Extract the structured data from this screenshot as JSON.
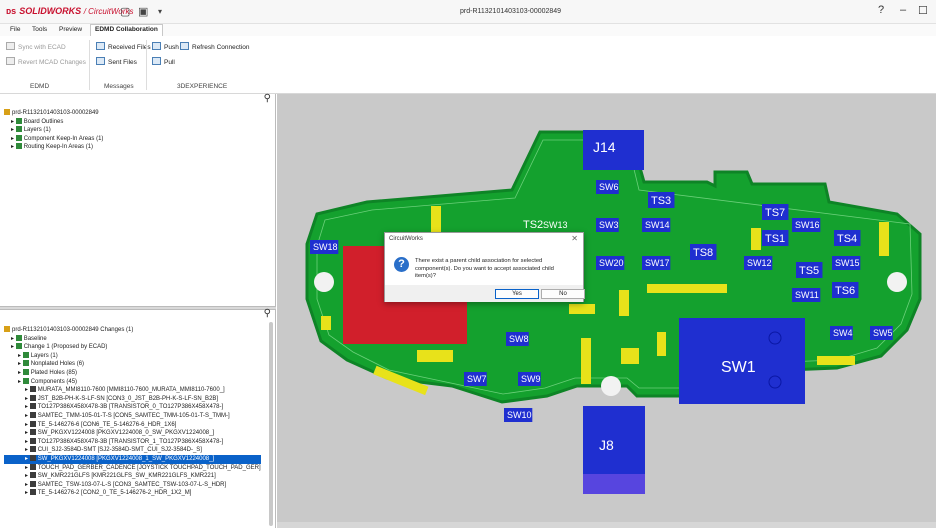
{
  "app": {
    "brand": "SOLIDWORKS",
    "product": "CircuitWorks",
    "doc_title": "prd-R1132101403103-00002849",
    "help_glyph": "?",
    "minimize_glyph": "–",
    "maximize_glyph": "☐"
  },
  "menu": {
    "tabs": [
      {
        "label": "File"
      },
      {
        "label": "Tools"
      },
      {
        "label": "Preview"
      },
      {
        "label": "EDMD Collaboration"
      }
    ]
  },
  "ribbon": {
    "sync_ecad": "Sync with ECAD",
    "revert_mcad": "Revert MCAD Changes",
    "received_files": "Received Files",
    "sent_files": "Sent Files",
    "push": "Push",
    "refresh": "Refresh Connection",
    "pull": "Pull",
    "groups": {
      "edmd": "EDMD",
      "messages": "Messages",
      "experience": "3DEXPERIENCE"
    }
  },
  "top_tree": [
    {
      "label": "prd-R1132101403103-00002849",
      "level": 0
    },
    {
      "label": "Board Outlines",
      "level": 1
    },
    {
      "label": "Layers (1)",
      "level": 1
    },
    {
      "label": "Component Keep-In Areas (1)",
      "level": 1
    },
    {
      "label": "Routing Keep-In Areas (1)",
      "level": 1
    }
  ],
  "bottom_tree": [
    {
      "label": "prd-R1132101403103-00002849  Changes  (1)",
      "level": 0
    },
    {
      "label": "Baseline",
      "level": 1
    },
    {
      "label": "Change 1 (Proposed by ECAD)",
      "level": 1
    },
    {
      "label": "Layers (1)",
      "level": 2
    },
    {
      "label": "Nonplated Holes (6)",
      "level": 2
    },
    {
      "label": "Plated Holes (85)",
      "level": 2
    },
    {
      "label": "Components (45)",
      "level": 2
    },
    {
      "label": "MURATA_MMI8110-7600 [MMI8110-7600_MURATA_MMI8110-7600_]",
      "level": 3
    },
    {
      "label": "JST_B2B-PH-K-S-LF-SN [CON3_0_JST_B2B-PH-K-S-LF-SN_B2B]",
      "level": 3
    },
    {
      "label": "TO127P386X458X478-3B [TRANSISTOR_0_TO127P386X458X478-]",
      "level": 3
    },
    {
      "label": "SAMTEC_TMM-105-01-T-S [CON5_SAMTEC_TMM-105-01-T-S_TMM-]",
      "level": 3
    },
    {
      "label": "TE_5-146276-6 [CON6_TE_5-146276-6_HDR_1X6]",
      "level": 3
    },
    {
      "label": "SW_PKGXV1224008 [PKGXV1224008_0_SW_PKGXV1224008_]",
      "level": 3
    },
    {
      "label": "TO127P386X458X478-3B [TRANSISTOR_1_TO127P386X458X478-]",
      "level": 3
    },
    {
      "label": "CUI_SJ2-3584D-SMT [SJ2-3584D-SMT_CUI_SJ2-3584D-_S]",
      "level": 3
    },
    {
      "label": "SW_PKGXV1224008 [PKGXV1224008_1_SW_PKGXV1224008_]",
      "level": 3,
      "selected": true
    },
    {
      "label": "TOUCH_PAD_GERBER_CADENCE [JOYSTICK TOUCHPAD_TOUCH_PAD_GER]",
      "level": 3
    },
    {
      "label": "SW_KMR221GLFS [KMR221GLFS_SW_KMR221GLFS_KMR221]",
      "level": 3
    },
    {
      "label": "SAMTEC_TSW-103-07-L-S [CON3_SAMTEC_TSW-103-07-L-S_HDR]",
      "level": 3
    },
    {
      "label": "TE_5-146276-2 [CON2_0_TE_5-146276-2_HDR_1X2_M]",
      "level": 3
    }
  ],
  "pcb": {
    "labels": {
      "J14": "J14",
      "SW6": "SW6",
      "TS3": "TS3",
      "TS2": "TS2",
      "SW13": "SW13",
      "SW3": "SW3",
      "SW14": "SW14",
      "TS7": "TS7",
      "TS1": "TS1",
      "SW16": "SW16",
      "TS4": "TS4",
      "SW18": "SW18",
      "SW20": "SW20",
      "SW17": "SW17",
      "TS8": "TS8",
      "SW12": "SW12",
      "TS5": "TS5",
      "SW15": "SW15",
      "SW11": "SW11",
      "TS6": "TS6",
      "SW8": "SW8",
      "SW4": "SW4",
      "SW5": "SW5",
      "SW1": "SW1",
      "SW7": "SW7",
      "SW9": "SW9",
      "SW10": "SW10",
      "J8": "J8"
    },
    "colors": {
      "board": "#14a12e",
      "board_dark": "#0c7d22",
      "component": "#1f2fd0",
      "highlight": "#d11f2b",
      "yellow": "#e8e21a"
    }
  },
  "dialog": {
    "title": "CircuitWorks",
    "close": "✕",
    "icon": "?",
    "message": "There exist a parent child association for selected component(s). Do you want to accept associated child item(s)?",
    "yes": "Yes",
    "no": "No"
  }
}
